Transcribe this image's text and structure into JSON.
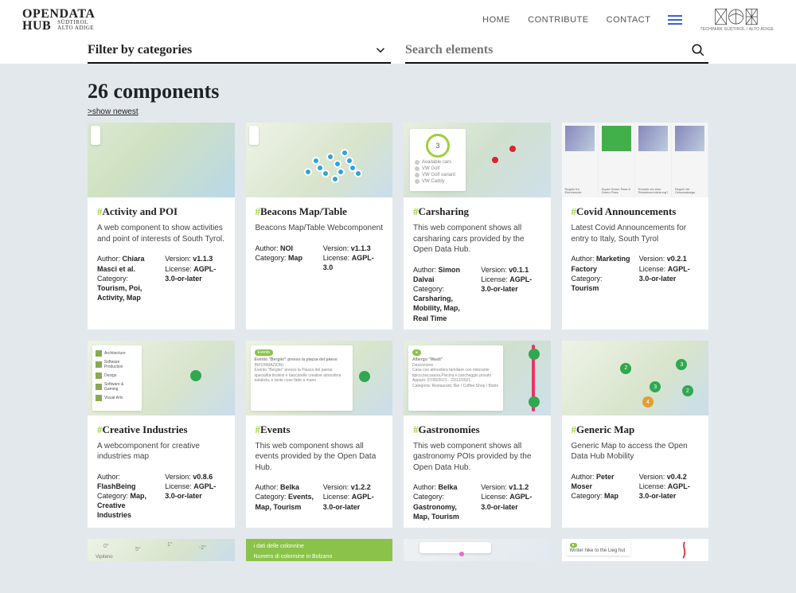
{
  "header": {
    "logo_line1": "OPENDATA",
    "logo_line2": "HUB",
    "logo_sub1": "SÜDTIROL",
    "logo_sub2": "ALTO ADIGE",
    "nav": {
      "home": "HOME",
      "contribute": "CONTRIBUTE",
      "contact": "CONTACT"
    },
    "partner_caption": "TECHPARK SÜDTIROL / ALTO ADIGE"
  },
  "filters": {
    "category_label": "Filter by categories",
    "search_placeholder": "Search elements"
  },
  "results": {
    "count_label": "26 components",
    "show_newest": ">show newest"
  },
  "cards": [
    {
      "title": "Activity and POI",
      "desc": "A web component to show activities and point of interests of South Tyrol.",
      "author": "Chiara Masci et al.",
      "category": "Tourism, Poi, Activity, Map",
      "version": "v1.1.3",
      "license": "AGPL-3.0-or-later"
    },
    {
      "title": "Beacons Map/Table",
      "desc": "Beacons Map/Table Webcomponent",
      "author": "NOI",
      "category": "Map",
      "version": "v1.1.3",
      "license": "AGPL-3.0"
    },
    {
      "title": "Carsharing",
      "desc": "This web component shows all carsharing cars provided by the Open Data Hub.",
      "author": "Simon Dalvai",
      "category": "Carsharing, Mobility, Map, Real Time",
      "version": "v0.1.1",
      "license": "AGPL-3.0-or-later"
    },
    {
      "title": "Covid Announcements",
      "desc": "Latest Covid Announcements for entry to Italy, South Tyrol",
      "author": "Marketing Factory",
      "category": "Tourism",
      "version": "v0.2.1",
      "license": "AGPL-3.0-or-later"
    },
    {
      "title": "Creative Industries",
      "desc": "A webcomponent for creative industries map",
      "author": "FlashBeing",
      "category": "Map, Creative Industries",
      "version": "v0.8.6",
      "license": "AGPL-3.0-or-later"
    },
    {
      "title": "Events",
      "desc": "This web component shows all events provided by the Open Data Hub.",
      "author": "Belka",
      "category": "Events, Map, Tourism",
      "version": "v1.2.2",
      "license": "AGPL-3.0-or-later"
    },
    {
      "title": "Gastronomies",
      "desc": "This web component shows all gastronomy POIs provided by the Open Data Hub.",
      "author": "Belka",
      "category": "Gastronomy, Map, Tourism",
      "version": "v1.1.2",
      "license": "AGPL-3.0-or-later"
    },
    {
      "title": "Generic Map",
      "desc": "Generic Map to access the Open Data Hub Mobility",
      "author": "Peter Moser",
      "category": "Map",
      "version": "v0.4.2",
      "license": "AGPL-3.0-or-later"
    }
  ],
  "labels": {
    "author": "Author: ",
    "category": "Category: ",
    "version": "Version: ",
    "license": "License: "
  },
  "thumb_hints": {
    "covid_segs": [
      "Regeln für Einreisende",
      "Super Green Pass & Green Pass",
      "Erwarte ich eine Reisebeschränkung?",
      "Regeln für Ortsansässige"
    ],
    "gastronomy_title": "Albergo \"Wastl\"",
    "events_pill": "Evento",
    "events_line": "Evento \"Bergler\" presso la piazza del paese",
    "hike_title": "Winter hike to the Lieg hut"
  }
}
